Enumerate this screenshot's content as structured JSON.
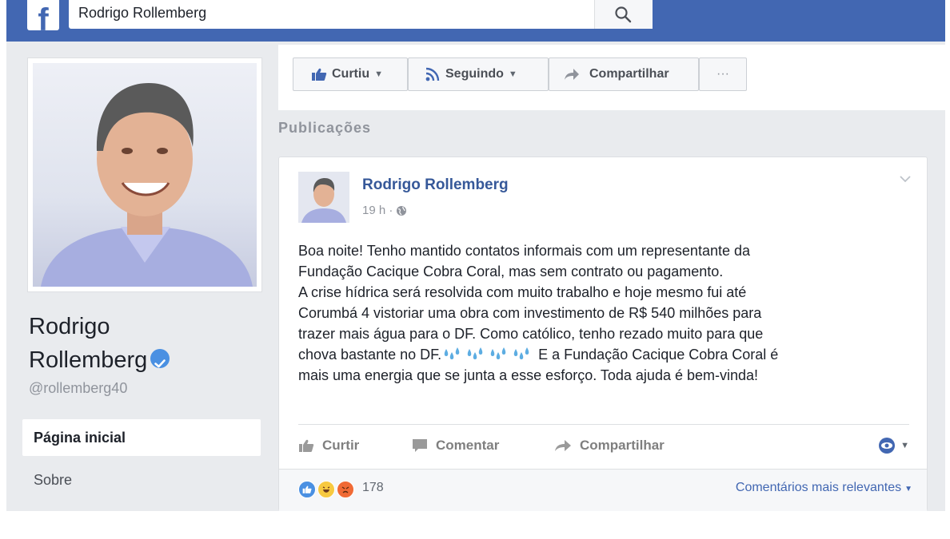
{
  "header": {
    "logo": "f",
    "search_value": "Rodrigo Rollemberg"
  },
  "profile": {
    "name_line1": "Rodrigo",
    "name_line2": "Rollemberg",
    "handle": "@rollemberg40",
    "nav": {
      "home": "Página inicial",
      "about": "Sobre"
    }
  },
  "actions": {
    "liked": "Curtiu",
    "following": "Seguindo",
    "share": "Compartilhar",
    "more": "···"
  },
  "section_title": "Publicações",
  "post": {
    "author": "Rodrigo Rollemberg",
    "time": "19 h ·",
    "body_lines": [
      "Boa noite! Tenho mantido contatos informais com um representante da",
      "Fundação Cacique Cobra Coral, mas sem contrato ou pagamento.",
      "A crise hídrica será resolvida com muito trabalho e hoje mesmo fui até",
      "Corumbá 4 vistoriar uma obra com investimento de R$ 540 milhões para",
      "trazer mais água para o DF. Como católico, tenho rezado muito para que",
      "chova bastante no DF.",
      " E a Fundação Cacique Cobra Coral é",
      "mais uma energia que se junta a esse esforço. Toda ajuda é bem-vinda!"
    ],
    "buttons": {
      "like": "Curtir",
      "comment": "Comentar",
      "share": "Compartilhar"
    },
    "reactions_count": "178",
    "comment_sort": "Comentários mais relevantes"
  },
  "colors": {
    "brand_blue": "#4267b2",
    "link_blue": "#365899",
    "verified_blue": "#4a90e2"
  }
}
